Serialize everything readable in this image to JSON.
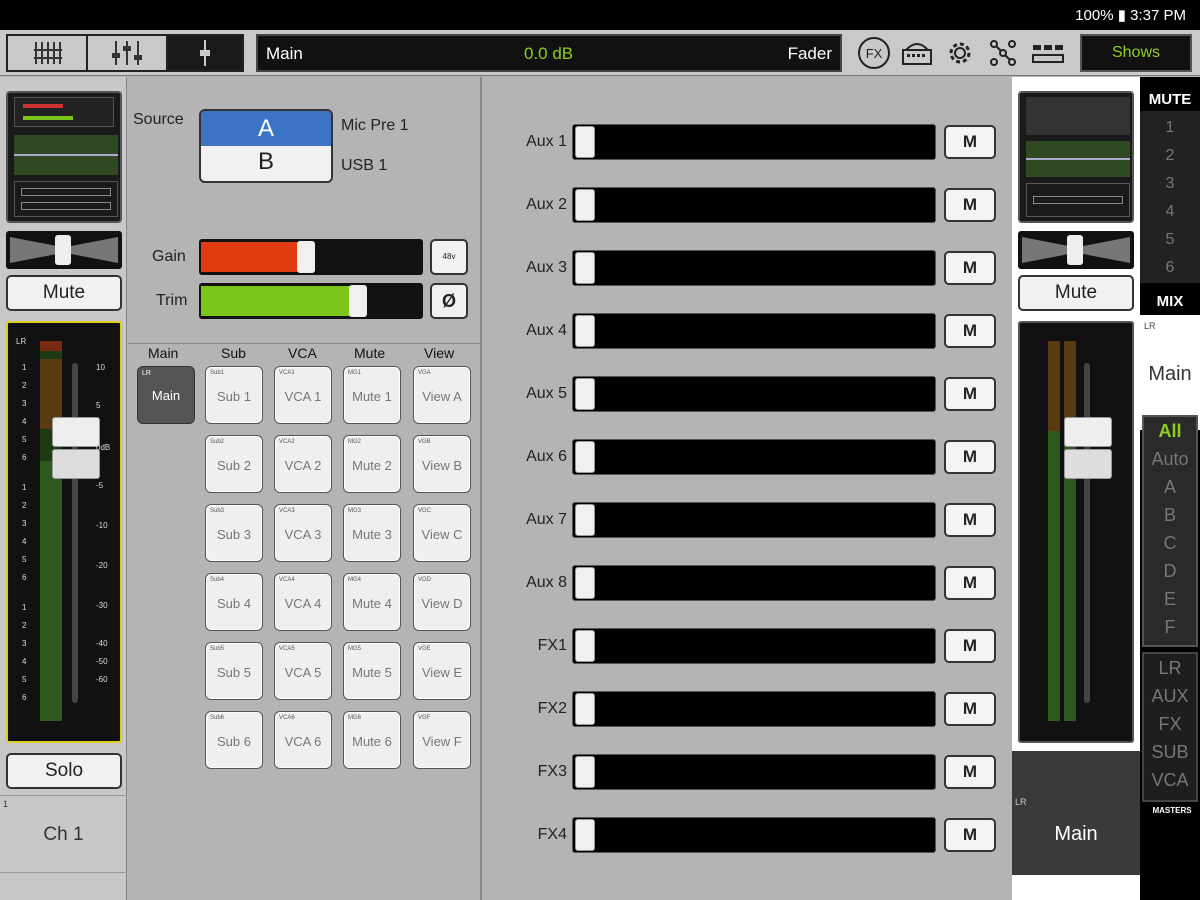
{
  "status": {
    "text": "100% ▮ 3:37 PM"
  },
  "toolbar": {
    "main_label": "Main",
    "level": "0.0 dB",
    "mode": "Fader",
    "fx_icon": "FX",
    "shows_label": "Shows"
  },
  "left_strip": {
    "mute_label": "Mute",
    "solo_label": "Solo",
    "channel_number": "1",
    "channel_name": "Ch 1",
    "meter_bus": "LR",
    "meter_ticks": [
      "1",
      "2",
      "3",
      "4",
      "5",
      "6",
      "1",
      "2",
      "3",
      "4",
      "5",
      "6",
      "1",
      "2",
      "3",
      "4",
      "5",
      "6"
    ],
    "scale": [
      "10",
      "5",
      "0dB",
      "-5",
      "-10",
      "-20",
      "-30",
      "-40",
      "-50",
      "-60"
    ]
  },
  "source": {
    "label": "Source",
    "a_label": "A",
    "b_label": "B",
    "a_value": "Mic Pre 1",
    "b_value": "USB 1"
  },
  "gain": {
    "label": "Gain",
    "level": 0.48,
    "phantom_label": "48v",
    "color": "#e03c10"
  },
  "trim": {
    "label": "Trim",
    "level": 0.72,
    "phase_label": "Ø",
    "color": "#7cc51b"
  },
  "assign": {
    "headers": [
      "Main",
      "Sub",
      "VCA",
      "Mute",
      "View"
    ],
    "main_btn": {
      "small": "LR",
      "label": "Main"
    },
    "sub": [
      {
        "small": "Sub1",
        "label": "Sub 1"
      },
      {
        "small": "Sub2",
        "label": "Sub 2"
      },
      {
        "small": "Sub3",
        "label": "Sub 3"
      },
      {
        "small": "Sub4",
        "label": "Sub 4"
      },
      {
        "small": "Sub5",
        "label": "Sub 5"
      },
      {
        "small": "Sub6",
        "label": "Sub 6"
      }
    ],
    "vca": [
      {
        "small": "VCA1",
        "label": "VCA 1"
      },
      {
        "small": "VCA2",
        "label": "VCA 2"
      },
      {
        "small": "VCA3",
        "label": "VCA 3"
      },
      {
        "small": "VCA4",
        "label": "VCA 4"
      },
      {
        "small": "VCA5",
        "label": "VCA 5"
      },
      {
        "small": "VCA6",
        "label": "VCA 6"
      }
    ],
    "mute": [
      {
        "small": "MG1",
        "label": "Mute 1"
      },
      {
        "small": "MG2",
        "label": "Mute 2"
      },
      {
        "small": "MG3",
        "label": "Mute 3"
      },
      {
        "small": "MG4",
        "label": "Mute 4"
      },
      {
        "small": "MG5",
        "label": "Mute 5"
      },
      {
        "small": "MG6",
        "label": "Mute 6"
      }
    ],
    "view": [
      {
        "small": "VGA",
        "label": "View A"
      },
      {
        "small": "VGB",
        "label": "View B"
      },
      {
        "small": "VGC",
        "label": "View C"
      },
      {
        "small": "VGD",
        "label": "View D"
      },
      {
        "small": "VGE",
        "label": "View E"
      },
      {
        "small": "VGF",
        "label": "View F"
      }
    ]
  },
  "sends": [
    {
      "label": "Aux 1",
      "m": "M"
    },
    {
      "label": "Aux 2",
      "m": "M"
    },
    {
      "label": "Aux 3",
      "m": "M"
    },
    {
      "label": "Aux 4",
      "m": "M"
    },
    {
      "label": "Aux 5",
      "m": "M"
    },
    {
      "label": "Aux 6",
      "m": "M"
    },
    {
      "label": "Aux 7",
      "m": "M"
    },
    {
      "label": "Aux 8",
      "m": "M"
    },
    {
      "label": "FX1",
      "m": "M"
    },
    {
      "label": "FX2",
      "m": "M"
    },
    {
      "label": "FX3",
      "m": "M"
    },
    {
      "label": "FX4",
      "m": "M"
    }
  ],
  "right_strip": {
    "mute_label": "Mute",
    "bus_small": "LR",
    "name": "Main"
  },
  "mute_panel": {
    "title": "MUTE",
    "items": [
      "1",
      "2",
      "3",
      "4",
      "5",
      "6"
    ],
    "mix_title": "MIX"
  },
  "mix_panel": {
    "bus_small": "LR",
    "name": "Main",
    "views": [
      "All",
      "Auto",
      "A",
      "B",
      "C",
      "D",
      "E",
      "F"
    ],
    "masters": [
      "LR",
      "AUX",
      "FX",
      "SUB",
      "VCA"
    ],
    "masters_label": "MASTERS",
    "active_color": "#8cd020"
  }
}
